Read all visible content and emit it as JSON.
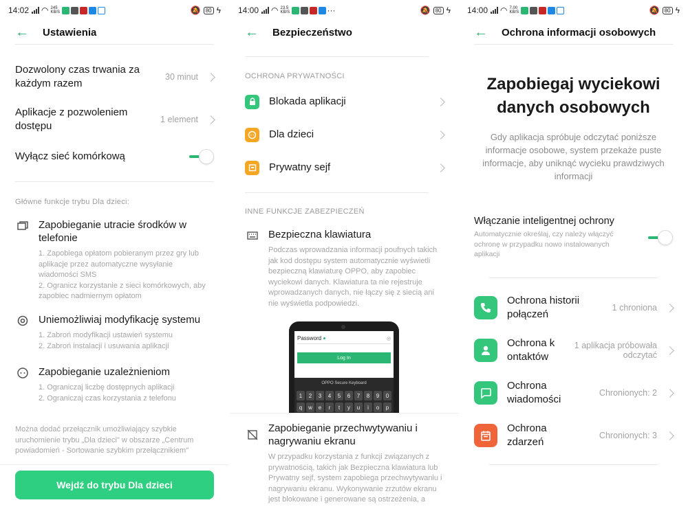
{
  "screen1": {
    "status": {
      "time": "14:02",
      "speed": "245 KB/S",
      "battery": "80"
    },
    "title": "Ustawienia",
    "rows": [
      {
        "label": "Dozwolony czas trwania za każdym razem",
        "value": "30 minut"
      },
      {
        "label": "Aplikacje z pozwoleniem dostępu",
        "value": "1 element"
      },
      {
        "label": "Wyłącz sieć komórkową"
      }
    ],
    "section_header": "Główne funkcje trybu Dla dzieci:",
    "features": [
      {
        "icon": "money-icon",
        "title": "Zapobieganie utracie środków w telefonie",
        "desc": [
          "1. Zapobiega opłatom pobieranym przez gry lub aplikacje przez automatyczne wysyłanie wiadomości SMS",
          "2. Ogranicz korzystanie z sieci komórkowych, aby zapobiec nadmiernym opłatom"
        ]
      },
      {
        "icon": "system-icon",
        "title": "Uniemożliwiaj modyfikację systemu",
        "desc": [
          "1. Zabroń modyfikacji ustawień systemu",
          "2. Zabroń instalacji i usuwania aplikacji"
        ]
      },
      {
        "icon": "child-face-icon",
        "title": "Zapobieganie uzależnieniom",
        "desc": [
          "1. Ograniczaj liczbę dostępnych aplikacji",
          "2. Ograniczaj czas korzystania z telefonu"
        ]
      }
    ],
    "footer_note": "Można dodać przełącznik umożliwiający szybkie uruchomienie trybu „Dla dzieci\" w obszarze „Centrum powiadomień - Sortowanie szybkim przełącznikiem\"",
    "button": "Wejdź do trybu Dla dzieci",
    "accent": "#2fcf82"
  },
  "screen2": {
    "status": {
      "time": "14:00",
      "speed": "23.5 KB/S",
      "battery": "80"
    },
    "title": "Bezpieczeństwo",
    "section1": "OCHRONA PRYWATNOŚCI",
    "items": [
      {
        "label": "Blokada aplikacji",
        "color": "#34c77b",
        "icon": "lock-icon"
      },
      {
        "label": "Dla dzieci",
        "color": "#f5a623",
        "icon": "kid-icon"
      },
      {
        "label": "Prywatny sejf",
        "color": "#f5a623",
        "icon": "safe-icon"
      }
    ],
    "section2": "INNE FUNKCJE ZABEZPIECZEŃ",
    "keyboard": {
      "title": "Bezpieczna klawiatura",
      "desc": "Podczas wprowadzania informacji poufnych takich jak kod dostępu system automatycznie wyświetli bezpieczną klawiaturę OPPO, aby zapobiec wyciekowi danych. Klawiatura ta nie rejestruje wprowadzanych danych, nie łączy się z siecią ani nie wyświetla podpowiedzi."
    },
    "phone": {
      "password_label": "Password",
      "login": "Log In",
      "keyboard_name": "OPPO Secure Keyboard",
      "row1": [
        "1",
        "2",
        "3",
        "4",
        "5",
        "6",
        "7",
        "8",
        "9",
        "0"
      ],
      "row2": [
        "q",
        "w",
        "e",
        "r",
        "t",
        "y",
        "u",
        "i",
        "o",
        "p"
      ]
    },
    "screen_capture": {
      "title": "Zapobieganie przechwytywaniu i nagrywaniu ekranu",
      "desc": "W przypadku korzystania z funkcji związanych z prywatnością, takich jak Bezpieczna klawiatura lub Prywatny sejf, system zapobiega przechwytywaniu i nagrywaniu ekranu. Wykonywanie zrzutów ekranu jest blokowane i generowane są ostrzeżenia, a"
    }
  },
  "screen3": {
    "status": {
      "time": "14:00",
      "speed": "7.00 KB/S",
      "battery": "80"
    },
    "title": "Ochrona informacji osobowych",
    "headline": "Zapobiegaj wyciekowi danych osobowych",
    "intro": "Gdy aplikacja spróbuje odczytać poniższe informacje osobowe, system przekaże puste informacje, aby uniknąć wycieku prawdziwych informacji",
    "smart": {
      "title": "Włączanie inteligentnej ochrony",
      "desc": "Automatycznie określaj, czy należy włączyć ochronę w przypadku nowo instalowanych aplikacji"
    },
    "items": [
      {
        "label": "Ochrona historii połączeń",
        "value": "1 chroniona",
        "color": "#34c77b",
        "icon": "phone-icon"
      },
      {
        "label": "Ochrona k ontaktów",
        "value": "1 aplikacja próbowała odczytać",
        "color": "#34c77b",
        "icon": "contact-icon"
      },
      {
        "label": "Ochrona wiadomości",
        "value": "Chronionych: 2",
        "color": "#34c77b",
        "icon": "message-icon"
      },
      {
        "label": "Ochrona zdarzeń",
        "value": "Chronionych: 3",
        "color": "#f0643a",
        "icon": "calendar-icon"
      }
    ]
  }
}
